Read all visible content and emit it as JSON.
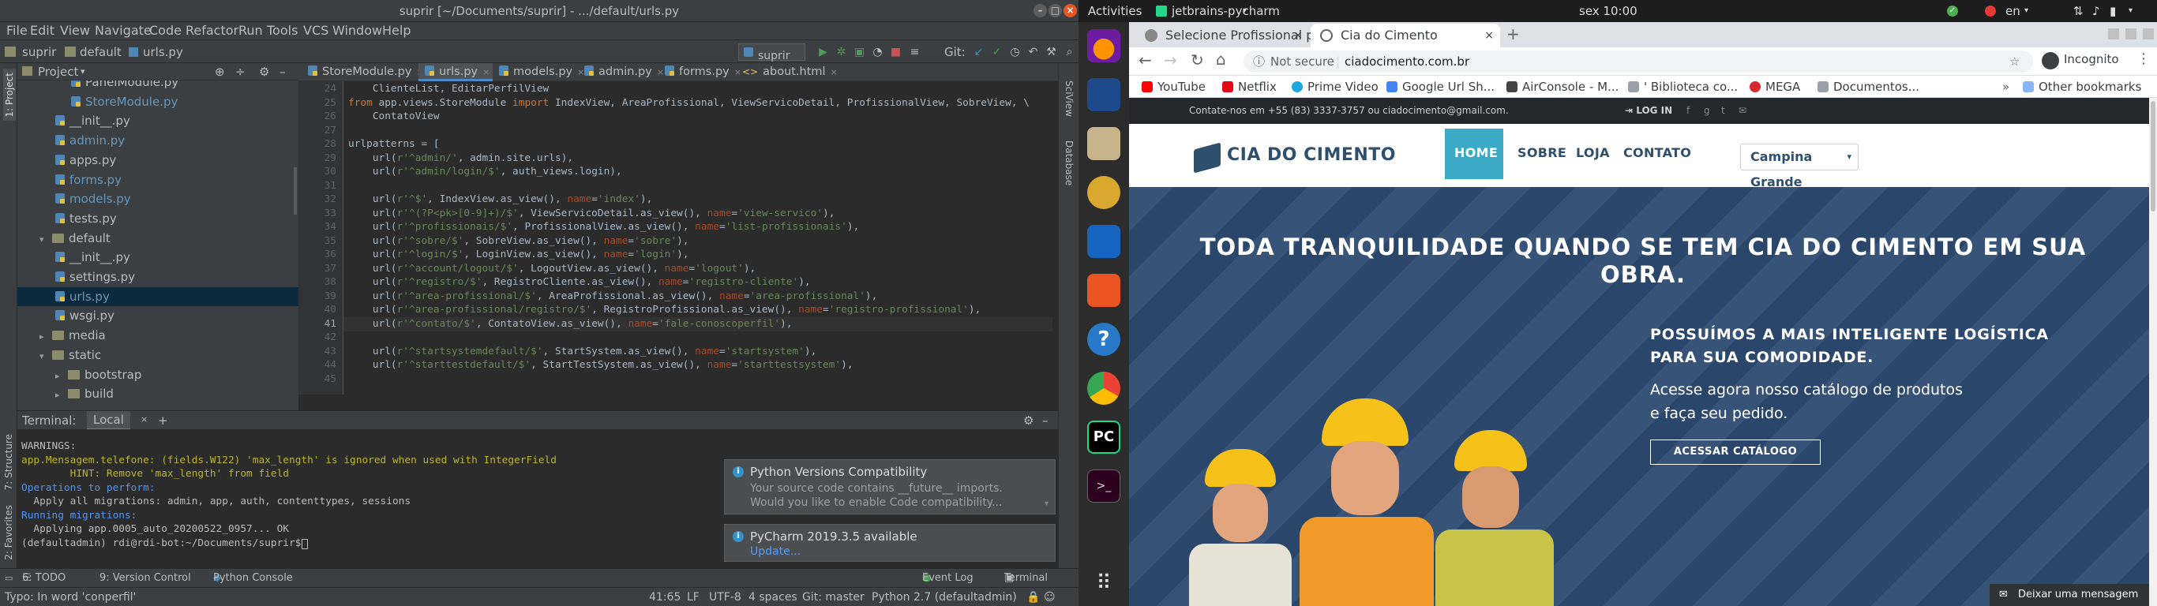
{
  "pycharm": {
    "title": "suprir [~/Documents/suprir] - .../default/urls.py",
    "menu": [
      "File",
      "Edit",
      "View",
      "Navigate",
      "Code",
      "Refactor",
      "Run",
      "Tools",
      "VCS",
      "Window",
      "Help"
    ],
    "breadcrumb": [
      "suprir",
      "default",
      "urls.py"
    ],
    "run_config": "suprir",
    "git_label": "Git:",
    "project_panel_title": "Project",
    "tree": [
      {
        "label": "PanelModule.py",
        "type": "py",
        "indent": 3,
        "color": "#bbbbbb"
      },
      {
        "label": "StoreModule.py",
        "type": "py",
        "indent": 3,
        "color": "#6897bb"
      },
      {
        "label": "__init__.py",
        "type": "py",
        "indent": 2,
        "color": "#bbbbbb"
      },
      {
        "label": "admin.py",
        "type": "py",
        "indent": 2,
        "color": "#6897bb"
      },
      {
        "label": "apps.py",
        "type": "py",
        "indent": 2,
        "color": "#bbbbbb"
      },
      {
        "label": "forms.py",
        "type": "py",
        "indent": 2,
        "color": "#6897bb"
      },
      {
        "label": "models.py",
        "type": "py",
        "indent": 2,
        "color": "#6897bb"
      },
      {
        "label": "tests.py",
        "type": "py",
        "indent": 2,
        "color": "#bbbbbb"
      },
      {
        "label": "default",
        "type": "folder-open",
        "indent": 1,
        "color": "#bbbbbb"
      },
      {
        "label": "__init__.py",
        "type": "py",
        "indent": 2,
        "color": "#bbbbbb"
      },
      {
        "label": "settings.py",
        "type": "py",
        "indent": 2,
        "color": "#bbbbbb"
      },
      {
        "label": "urls.py",
        "type": "py",
        "indent": 2,
        "color": "#6897bb",
        "selected": true
      },
      {
        "label": "wsgi.py",
        "type": "py",
        "indent": 2,
        "color": "#bbbbbb"
      },
      {
        "label": "media",
        "type": "folder",
        "indent": 1,
        "color": "#bbbbbb"
      },
      {
        "label": "static",
        "type": "folder-open",
        "indent": 1,
        "color": "#bbbbbb"
      },
      {
        "label": "bootstrap",
        "type": "folder",
        "indent": 2,
        "color": "#bbbbbb"
      },
      {
        "label": "build",
        "type": "folder",
        "indent": 2,
        "color": "#bbbbbb"
      }
    ],
    "editor_tabs": [
      "StoreModule.py",
      "urls.py",
      "models.py",
      "admin.py",
      "forms.py",
      "about.html"
    ],
    "active_tab": 1,
    "line_numbers": [
      "24",
      "25",
      "26",
      "27",
      "28",
      "29",
      "30",
      "31",
      "32",
      "33",
      "34",
      "35",
      "36",
      "37",
      "38",
      "39",
      "40",
      "41",
      "42",
      "43",
      "44",
      "45"
    ],
    "code_lines": [
      "    ClienteList, EditarPerfilView",
      "from app.views.StoreModule import IndexView, AreaProfissional, ViewServicoDetail, ProfissionalView, SobreView, \\",
      "    ContatoView",
      "",
      "urlpatterns = [",
      "    url(r'^admin/', admin.site.urls),",
      "    url(r'^admin/login/$', auth_views.login),",
      "",
      "    url(r'^$', IndexView.as_view(), name='index'),",
      "    url(r'^(?P<pk>[0-9]+)/$', ViewServicoDetail.as_view(), name='view-servico'),",
      "    url(r'^profissionais/$', ProfissionalView.as_view(), name='list-profissionais'),",
      "    url(r'^sobre/$', SobreView.as_view(), name='sobre'),",
      "    url(r'^login/$', LoginView.as_view(), name='login'),",
      "    url(r'^account/logout/$', LogoutView.as_view(), name='logout'),",
      "    url(r'^registro/$', RegistroCliente.as_view(), name='registro-cliente'),",
      "    url(r'^area-profissional/$', AreaProfissional.as_view(), name='area-profissional'),",
      "    url(r'^area-profissional/registro/$', RegistroProfissional.as_view(), name='registro-profissional'),",
      "    url(r'^contato/$', ContatoView.as_view(), name='fale-conoscoperfil'),",
      "",
      "    url(r'^startsystemdefault/$', StartSystem.as_view(), name='startsystem'),",
      "    url(r'^starttestdefault/$', StartTestSystem.as_view(), name='starttestsystem'),",
      ""
    ],
    "terminal_label": "Terminal:",
    "terminal_tab": "Local",
    "terminal_lines": [
      {
        "text": "WARNINGS:",
        "cls": ""
      },
      {
        "text": "app.Mensagem.telefone: (fields.W122) 'max_length' is ignored when used with IntegerField",
        "cls": "ty"
      },
      {
        "text": "        HINT: Remove 'max_length' from field",
        "cls": "ty"
      },
      {
        "text": "Operations to perform:",
        "cls": "tb2"
      },
      {
        "text": "  Apply all migrations: admin, app, auth, contenttypes, sessions",
        "cls": ""
      },
      {
        "text": "Running migrations:",
        "cls": "tb2"
      },
      {
        "text": "  Applying app.0005_auto_20200522_0957... OK",
        "cls": ""
      },
      {
        "text": "(defaultadmin) rdi@rdi-bot:~/Documents/suprir$ ",
        "cls": "prompt"
      }
    ],
    "notif1": {
      "title": "Python Versions Compatibility",
      "body1": "Your source code contains __future__ imports.",
      "body2": "Would you like to enable Code compatibility..."
    },
    "notif2": {
      "title": "PyCharm 2019.3.5 available",
      "link": "Update..."
    },
    "toolwindows": {
      "todo": "6: TODO",
      "vcs": "9: Version Control",
      "console": "Python Console",
      "event_log": "Event Log",
      "terminal": "Terminal"
    },
    "left_strip": {
      "project": "1: Project",
      "structure": "7: Structure",
      "favorites": "2: Favorites"
    },
    "right_strip": {
      "sciview": "SciView",
      "database": "Database"
    },
    "status": {
      "typo": "Typo: In word 'conperfil'",
      "pos": "41:65",
      "lf": "LF",
      "enc": "UTF-8",
      "indent": "4 spaces",
      "git": "Git: master",
      "interp": "Python 2.7 (defaultadmin)"
    }
  },
  "topbar": {
    "activities": "Activities",
    "app": "jetbrains-pycharm",
    "clock": "sex 10:00",
    "lang": "en"
  },
  "chrome": {
    "tabs": [
      {
        "title": "Selecione Profissional pa"
      },
      {
        "title": "Cia do Cimento"
      }
    ],
    "url_security": "Not secure",
    "url": "ciadocimento.com.br",
    "incognito": "Incognito",
    "bookmarks": [
      {
        "label": "YouTube",
        "color": "#ff0000"
      },
      {
        "label": "Netflix",
        "color": "#e50914"
      },
      {
        "label": "Prime Video",
        "color": "#1ba7e0"
      },
      {
        "label": "Google Url Sh...",
        "color": "#4285f4"
      },
      {
        "label": "AirConsole - M...",
        "color": "#444444"
      },
      {
        "label": "' Biblioteca co...",
        "color": "#9aa0a6"
      },
      {
        "label": "MEGA",
        "color": "#d9272e"
      },
      {
        "label": "Documentos...",
        "color": "#9aa0a6"
      }
    ],
    "other_bookmarks": "Other bookmarks"
  },
  "site": {
    "contact": "Contate-nos em +55 (83) 3337-3757 ou ciadocimento@gmail.com.",
    "login": "LOG IN",
    "logo": "CIA DO CIMENTO",
    "nav": [
      "HOME",
      "SOBRE",
      "LOJA",
      "CONTATO"
    ],
    "city": "Campina Grande",
    "headline1": "TODA TRANQUILIDADE QUANDO SE TEM CIA DO CIMENTO EM SUA",
    "headline2": "OBRA.",
    "sub1": "POSSUÍMOS A MAIS INTELIGENTE LOGÍSTICA",
    "sub2": "PARA SUA COMODIDADE.",
    "para1": "Acesse agora nosso catálogo de produtos",
    "para2": "e faça seu pedido.",
    "cta": "ACESSAR CATÁLOGO",
    "chat": "Deixar uma mensagem"
  }
}
